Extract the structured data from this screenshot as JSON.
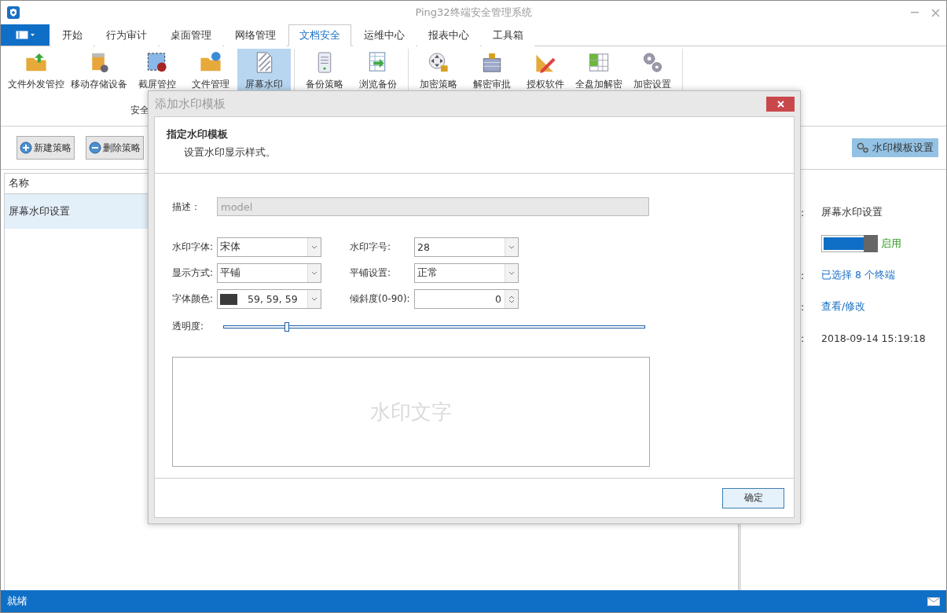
{
  "window": {
    "title": "Ping32终端安全管理系统"
  },
  "tabs": [
    {
      "label": "开始",
      "selected": false
    },
    {
      "label": "行为审计",
      "selected": false
    },
    {
      "label": "桌面管理",
      "selected": false
    },
    {
      "label": "网络管理",
      "selected": false
    },
    {
      "label": "文档安全",
      "selected": true
    },
    {
      "label": "运维中心",
      "selected": false
    },
    {
      "label": "报表中心",
      "selected": false
    },
    {
      "label": "工具箱",
      "selected": false
    }
  ],
  "ribbon": {
    "groups": [
      {
        "label": "安全",
        "items": [
          {
            "label": "文件外发管控",
            "selected": false
          },
          {
            "label": "移动存储设备",
            "selected": false
          },
          {
            "label": "截屏管控",
            "selected": false
          },
          {
            "label": "文件管理",
            "selected": false
          },
          {
            "label": "屏幕水印",
            "selected": true
          }
        ]
      },
      {
        "items": [
          {
            "label": "备份策略",
            "selected": false
          },
          {
            "label": "浏览备份",
            "selected": false
          }
        ]
      },
      {
        "items": [
          {
            "label": "加密策略",
            "selected": false
          },
          {
            "label": "解密审批",
            "selected": false
          },
          {
            "label": "授权软件",
            "selected": false
          },
          {
            "label": "全盘加解密",
            "selected": false
          },
          {
            "label": "加密设置",
            "selected": false
          }
        ]
      }
    ]
  },
  "toolbar": {
    "buttons": [
      {
        "label": "新建策略",
        "kind": "add"
      },
      {
        "label": "删除策略",
        "kind": "remove"
      }
    ],
    "template_button": "水印模板设置"
  },
  "policy_list": {
    "columns": [
      "名称"
    ],
    "rows": [
      {
        "name": "屏幕水印设置",
        "selected": true
      }
    ]
  },
  "details": [
    {
      "kind": "text",
      "colon": ":",
      "value": "屏幕水印设置"
    },
    {
      "kind": "switch",
      "on": true,
      "value": "启用"
    },
    {
      "kind": "link",
      "colon": ":",
      "value": "已选择 8 个终端"
    },
    {
      "kind": "link",
      "colon": ":",
      "value": "查看/修改"
    },
    {
      "kind": "text",
      "colon": ":",
      "value": "2018-09-14 15:19:18"
    }
  ],
  "dialog": {
    "title": "添加水印模板",
    "heading": "指定水印模板",
    "subheading": "设置水印显示样式。",
    "description": {
      "label": "描述：",
      "value": "model"
    },
    "fields": [
      {
        "kind": "select",
        "label": "水印字体:",
        "value": "宋体"
      },
      {
        "kind": "select",
        "label": "水印字号:",
        "value": "28"
      },
      {
        "kind": "select",
        "label": "显示方式:",
        "value": "平铺"
      },
      {
        "kind": "select",
        "label": "平铺设置:",
        "value": "正常"
      },
      {
        "kind": "color",
        "label": "字体颜色:",
        "value": "59, 59, 59",
        "color": "#3b3b3b"
      },
      {
        "kind": "spin",
        "label": "倾斜度(0-90):",
        "value": "0"
      }
    ],
    "opacity": {
      "label": "透明度:",
      "level": 0.15
    },
    "preview_text": "水印文字",
    "ok_button": "确定"
  },
  "status_bar": {
    "text": "就绪"
  }
}
